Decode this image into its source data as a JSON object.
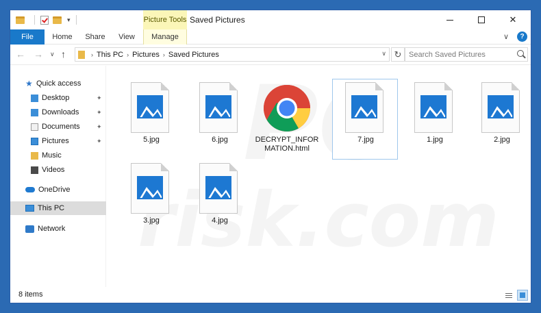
{
  "window": {
    "title": "Saved Pictures",
    "contextual_tab": "Picture Tools"
  },
  "ribbon": {
    "tabs": [
      "File",
      "Home",
      "Share",
      "View",
      "Manage"
    ],
    "help": "?"
  },
  "address": {
    "breadcrumb": [
      "This PC",
      "Pictures",
      "Saved Pictures"
    ],
    "search_placeholder": "Search Saved Pictures"
  },
  "sidebar": {
    "items": [
      {
        "label": "Quick access",
        "icon": "star-icon",
        "pinned": false
      },
      {
        "label": "Desktop",
        "icon": "desktop-folder-icon",
        "pinned": true
      },
      {
        "label": "Downloads",
        "icon": "downloads-folder-icon",
        "pinned": true
      },
      {
        "label": "Documents",
        "icon": "documents-folder-icon",
        "pinned": true
      },
      {
        "label": "Pictures",
        "icon": "pictures-folder-icon",
        "pinned": true
      },
      {
        "label": "Music",
        "icon": "music-folder-icon",
        "pinned": false
      },
      {
        "label": "Videos",
        "icon": "videos-folder-icon",
        "pinned": false
      },
      {
        "label": "OneDrive",
        "icon": "onedrive-icon",
        "pinned": false
      },
      {
        "label": "This PC",
        "icon": "this-pc-icon",
        "pinned": false,
        "selected": true
      },
      {
        "label": "Network",
        "icon": "network-icon",
        "pinned": false
      }
    ]
  },
  "files": [
    {
      "name": "5.jpg",
      "type": "image"
    },
    {
      "name": "6.jpg",
      "type": "image"
    },
    {
      "name": "DECRYPT_INFORMATION.html",
      "type": "html",
      "label_line1": "DECRYPT_INFOR",
      "label_line2": "MATION.html"
    },
    {
      "name": "7.jpg",
      "type": "image",
      "selected": true
    },
    {
      "name": "1.jpg",
      "type": "image"
    },
    {
      "name": "2.jpg",
      "type": "image"
    },
    {
      "name": "3.jpg",
      "type": "image"
    },
    {
      "name": "4.jpg",
      "type": "image"
    }
  ],
  "watermark": {
    "line1": "PC",
    "line2": "risk.com"
  },
  "status": {
    "item_count": "8 items"
  },
  "colors": {
    "accent": "#1979ca",
    "picture_tools": "#fbf6b8",
    "folder": "#e9b949",
    "image_thumb": "#1d78d2"
  }
}
